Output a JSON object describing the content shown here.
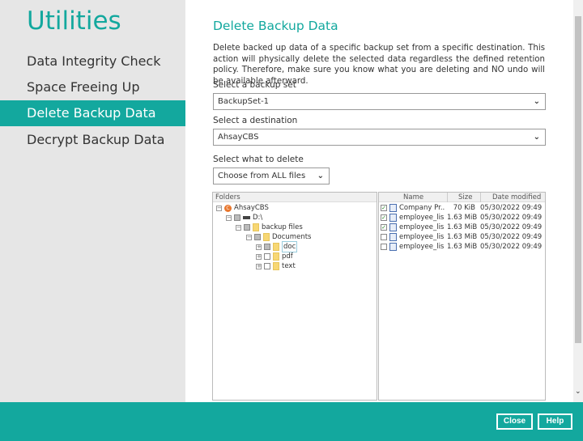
{
  "sidebar": {
    "title": "Utilities",
    "items": [
      {
        "label": "Data Integrity Check"
      },
      {
        "label": "Space Freeing Up"
      },
      {
        "label": "Delete Backup Data",
        "active": true
      },
      {
        "label": "Decrypt Backup Data"
      }
    ]
  },
  "main": {
    "title": "Delete Backup Data",
    "description": "Delete backed up data of a specific backup set from a specific destination. This action will physically delete the selected data regardless the defined retention policy. Therefore, make sure you know what you are deleting and NO undo will be available afterward.",
    "backup_set_label": "Select a backup set",
    "backup_set_value": "BackupSet-1",
    "destination_label": "Select a destination",
    "destination_value": "AhsayCBS",
    "what_label": "Select what to delete",
    "what_value": "Choose from ALL files"
  },
  "folders": {
    "header": "Folders",
    "tree": [
      {
        "label": "AhsayCBS"
      },
      {
        "label": "D:\\"
      },
      {
        "label": "backup files"
      },
      {
        "label": "Documents"
      },
      {
        "label": "doc"
      },
      {
        "label": "pdf"
      },
      {
        "label": "text"
      }
    ]
  },
  "files": {
    "columns": [
      "Name",
      "Size",
      "Date modified"
    ],
    "rows": [
      {
        "name": "Company Pr...",
        "size": "70 KiB",
        "date": "05/30/2022 09:49",
        "checked": true
      },
      {
        "name": "employee_lis...",
        "size": "1.63 MiB",
        "date": "05/30/2022 09:49",
        "checked": true
      },
      {
        "name": "employee_lis...",
        "size": "1.63 MiB",
        "date": "05/30/2022 09:49",
        "checked": true
      },
      {
        "name": "employee_lis...",
        "size": "1.63 MiB",
        "date": "05/30/2022 09:49",
        "checked": false
      },
      {
        "name": "employee_lis...",
        "size": "1.63 MiB",
        "date": "05/30/2022 09:49",
        "checked": false
      }
    ]
  },
  "footer": {
    "close": "Close",
    "help": "Help"
  },
  "colors": {
    "accent": "#13a89e"
  }
}
